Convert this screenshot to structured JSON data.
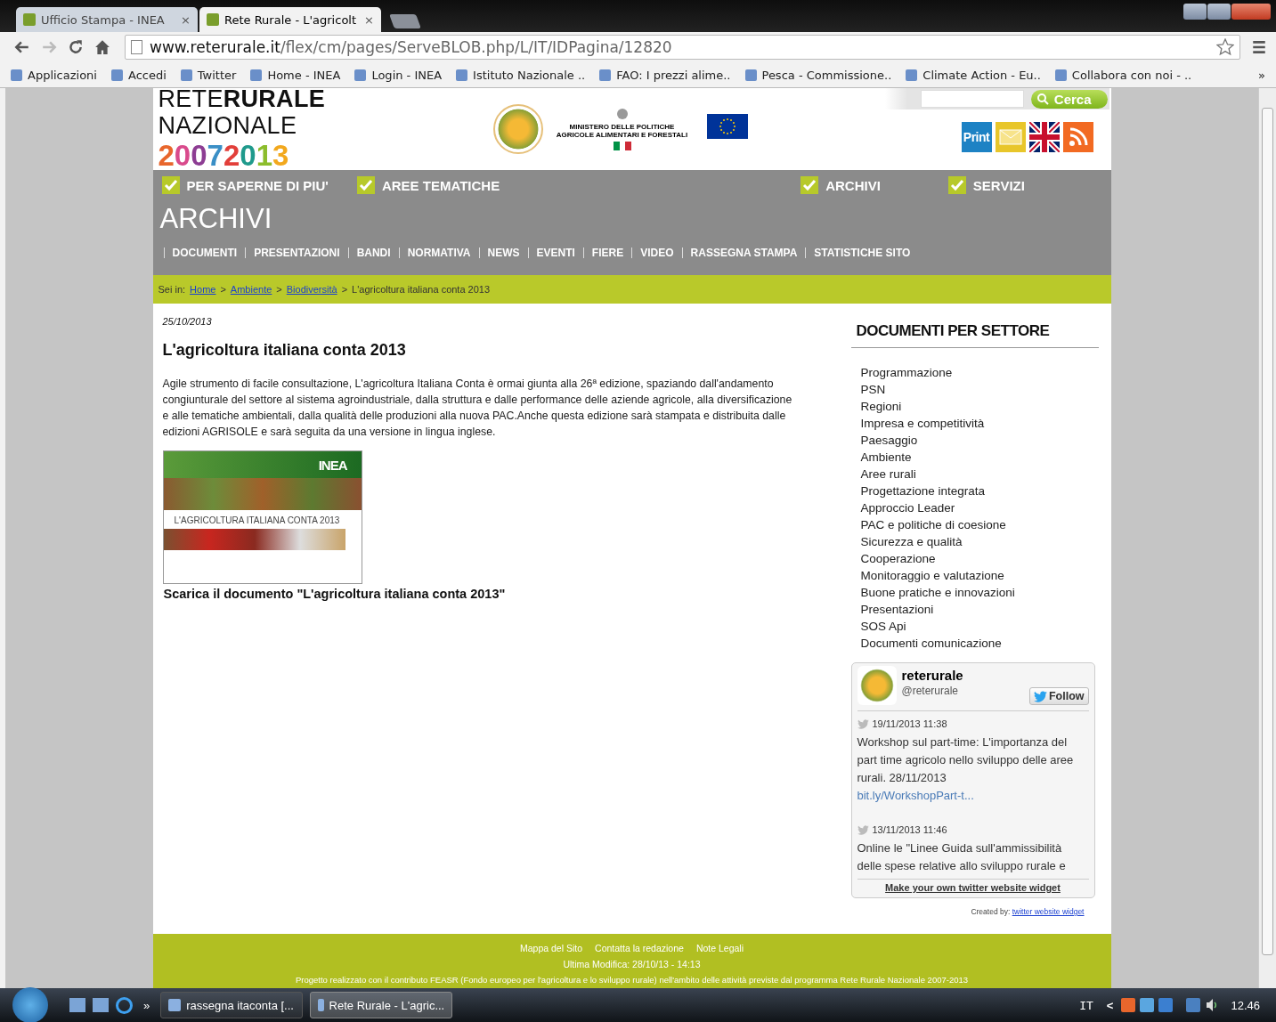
{
  "browser": {
    "tabs": [
      {
        "title": "Ufficio Stampa - INEA",
        "close": "×",
        "selected": false
      },
      {
        "title": "Rete Rurale - L'agricolt",
        "close": "×",
        "selected": true
      }
    ],
    "url_host": "www.reterurale.it",
    "url_path": "/flex/cm/pages/ServeBLOB.php/L/IT/IDPagina/12820",
    "bookmarks": [
      "Applicazioni",
      "Accedi",
      "Twitter",
      "Home - INEA",
      "Login - INEA",
      "Istituto Nazionale ..",
      "FAO: I prezzi alime..",
      "Pesca - Commissione..",
      "Climate Action - Eu..",
      "Collabora con noi - .."
    ],
    "bookmarks_more": "»"
  },
  "site": {
    "logo": [
      "RETE**RURALE**",
      "NAZIONALE",
      "20072013"
    ],
    "ministry": "MINISTERO DELLE POLITICHE AGRICOLE ALIMENTARI E FORESTALI",
    "search": {
      "button": "Cerca"
    },
    "print": "Print",
    "top_menu": [
      "PER SAPERNE DI PIU'",
      "AREE TEMATICHE",
      "ARCHIVI",
      "SERVIZI"
    ],
    "section_title": "ARCHIVI",
    "sub_menu": [
      "DOCUMENTI",
      "PRESENTAZIONI",
      "BANDI",
      "NORMATIVA",
      "NEWS",
      "EVENTI",
      "FIERE",
      "VIDEO",
      "RASSEGNA STAMPA",
      "STATISTICHE SITO"
    ],
    "breadcrumb": {
      "label": "Sei in:",
      "links": [
        "Home",
        "Ambiente",
        "Biodiversità"
      ],
      "separator": ">",
      "current": "L'agricoltura italiana conta 2013"
    }
  },
  "article": {
    "date": "25/10/2013",
    "title": "L'agricoltura italiana conta 2013",
    "body": "Agile strumento di facile consultazione, L'agricoltura Italiana Conta è ormai giunta alla 26ª edizione, spaziando dall'andamento congiunturale del settore al sistema agroindustriale, dalla struttura e dalle performance delle aziende agricole, alla diversificazione e alle tematiche ambientali, dalla qualità delle produzioni alla nuova PAC.Anche questa edizione sarà stampata e distribuita dalle edizioni AGRISOLE e sarà seguita da una versione in lingua inglese.",
    "cover": {
      "logo": "INEA",
      "title": "L'AGRICOLTURA ITALIANA CONTA 2013"
    },
    "download": "Scarica il documento \"L'agricoltura italiana conta 2013\""
  },
  "sidebar": {
    "title": "DOCUMENTI PER SETTORE",
    "items": [
      "Programmazione",
      "PSN",
      "Regioni",
      "Impresa e competitività",
      "Paesaggio",
      "Ambiente",
      "Aree rurali",
      "Progettazione integrata",
      "Approccio Leader",
      "PAC e politiche di coesione",
      "Sicurezza e qualità",
      "Cooperazione",
      "Monitoraggio e valutazione",
      "Buone pratiche e innovazioni",
      "Presentazioni",
      "SOS Api",
      "Documenti comunicazione"
    ],
    "twitter": {
      "name": "reterurale",
      "handle": "@reterurale",
      "follow": "Follow",
      "tweets": [
        {
          "time": "19/11/2013 11:38",
          "text": "Workshop sul part-time: L'importanza del part time agricolo nello sviluppo delle aree rurali. 28/11/2013",
          "link": "bit.ly/WorkshopPart-t..."
        },
        {
          "time": "13/11/2013 11:46",
          "text": "Online le \"Linee Guida sull'ammissibilità delle spese relative allo sviluppo rurale e"
        }
      ],
      "make_own": "Make your own twitter website widget"
    },
    "credit": {
      "label": "Created by:",
      "link": "twitter website widget"
    }
  },
  "footer": {
    "links": [
      "Mappa del Sito",
      "Contatta la redazione",
      "Note Legali"
    ],
    "modified": "Ultima Modifica: 28/10/13 - 14:13",
    "note": "Progetto realizzato con il contributo FEASR (Fondo europeo per l'agricoltura e lo sviluppo rurale) nell'ambito delle attività previste dal programma Rete Rurale Nazionale 2007-2013"
  },
  "taskbar": {
    "more": "»",
    "tasks": [
      {
        "title": "rassegna itaconta [...",
        "selected": false
      },
      {
        "title": "Rete Rurale - L'agric...",
        "selected": true
      }
    ],
    "language": "IT",
    "tray_arrow": "<",
    "clock": "12.46"
  }
}
